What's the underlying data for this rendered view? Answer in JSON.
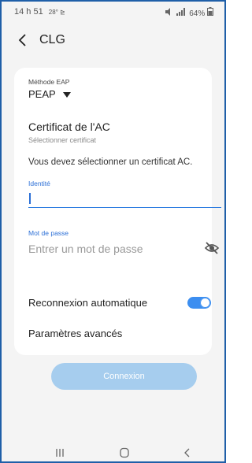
{
  "status_bar": {
    "time": "14 h 51",
    "left_icons": "28° ⊵",
    "battery": "64%"
  },
  "header": {
    "title": "CLG"
  },
  "form": {
    "eap_method_label": "Méthode EAP",
    "eap_method_value": "PEAP",
    "ca_cert_title": "Certificat de l'AC",
    "ca_cert_subtitle": "Sélectionner certificat",
    "ca_cert_message": "Vous devez sélectionner un certificat AC.",
    "identity_label": "Identité",
    "identity_value": "",
    "password_label": "Mot de passe",
    "password_placeholder": "Entrer un mot de passe",
    "auto_reconnect_label": "Reconnexion automatique",
    "auto_reconnect_on": true,
    "advanced_label": "Paramètres avancés"
  },
  "connect_button": {
    "label": "Connexion"
  },
  "colors": {
    "accent": "#2b6fd6",
    "toggle_on": "#3c8ef0",
    "connect_disabled": "#a6cdee"
  }
}
